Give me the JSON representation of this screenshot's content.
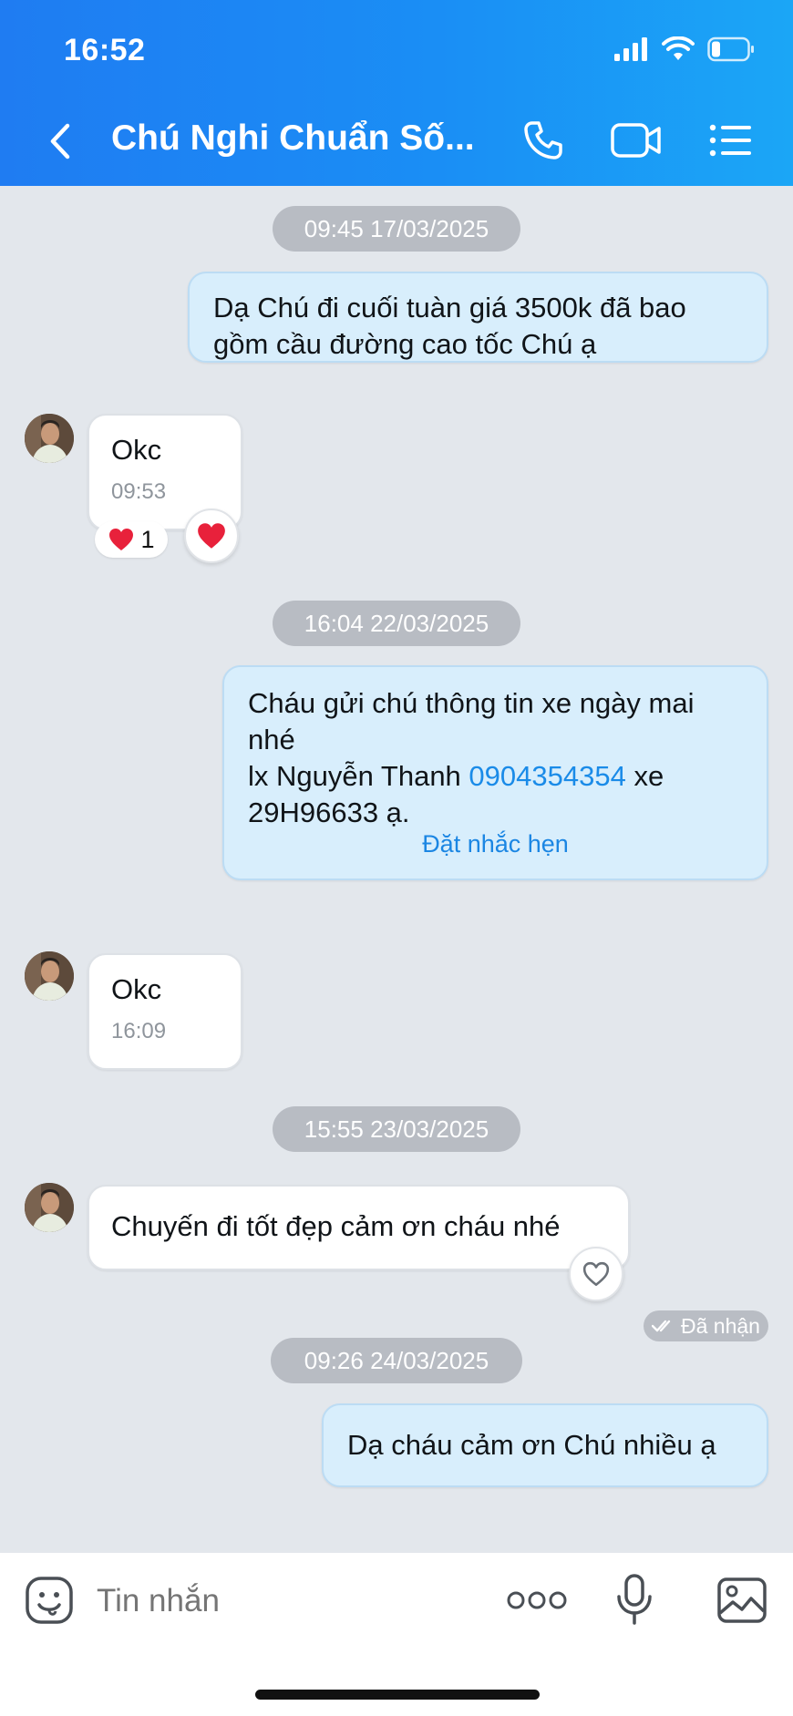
{
  "status_bar": {
    "time": "16:52"
  },
  "header": {
    "title": "Chú Nghi Chuẩn Số..."
  },
  "messages": {
    "ts1": "09:45 17/03/2025",
    "m1_line1": "Dạ Chú đi cuối tuàn giá 3500k đã bao",
    "m1_line2": "gồm cầu đường cao tốc Chú ạ",
    "m2_text": "Okc",
    "m2_time": "09:53",
    "m2_reaction_count": "1",
    "ts2": "16:04 22/03/2025",
    "m3_line1": "Cháu gửi chú thông tin xe ngày mai",
    "m3_line2": "nhé",
    "m3_line3_prefix": "lx Nguyễn Thanh ",
    "m3_phone": "0904354354",
    "m3_line3_suffix": " xe",
    "m3_line4": "29H96633 ạ.",
    "m3_action": "Đặt nhắc hẹn",
    "m4_text": "Okc",
    "m4_time": "16:09",
    "ts3": "15:55 23/03/2025",
    "m5_text": "Chuyến đi tốt đẹp cảm ơn cháu nhé",
    "ts4": "09:26 24/03/2025",
    "m6_text": "Dạ cháu cảm ơn Chú nhiều ạ",
    "m6_status": "Đã nhận"
  },
  "input": {
    "placeholder": "Tin nhắn"
  },
  "icons": {
    "signal": "cellular-signal-icon",
    "wifi": "wifi-icon",
    "battery": "battery-icon",
    "back": "chevron-left-icon",
    "call": "phone-icon",
    "video": "video-camera-icon",
    "menu": "list-menu-icon",
    "emoji": "emoji-sticker-icon",
    "more": "more-dots-icon",
    "mic": "microphone-icon",
    "image": "image-gallery-icon",
    "heart": "heart-icon"
  },
  "colors": {
    "header_gradient_start": "#1f7cf2",
    "header_gradient_end": "#1ba6f6",
    "outgoing_bubble": "#d8eefc",
    "incoming_bubble": "#ffffff",
    "chat_background": "#e3e7ec",
    "link": "#1a8be8"
  }
}
